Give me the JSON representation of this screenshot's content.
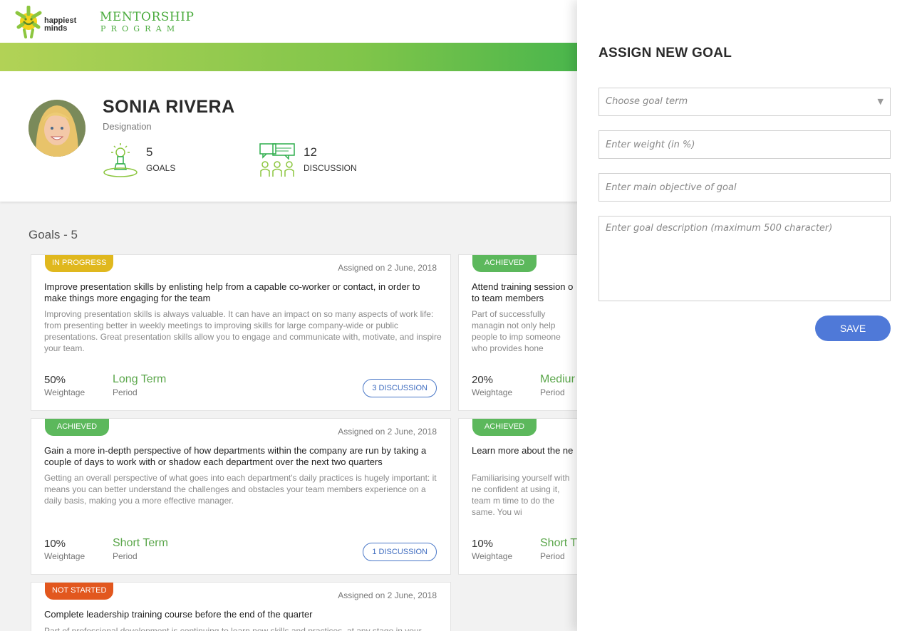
{
  "header": {
    "logo_text_1": "happiest",
    "logo_text_2": "minds",
    "title": "MENTORSHIP",
    "subtitle": "PROGRAM"
  },
  "profile": {
    "name": "SONIA RIVERA",
    "designation": "Designation",
    "stats": {
      "goals_count": "5",
      "goals_label": "GOALS",
      "discussion_count": "12",
      "discussion_label": "DISCUSSION"
    }
  },
  "goals_heading": "Goals - 5",
  "goals": [
    {
      "status": "IN PROGRESS",
      "status_color": "#e0b81e",
      "assigned": "Assigned on 2 June, 2018",
      "title": "Improve presentation skills by enlisting help from a capable co-worker or contact, in order to make things more engaging for the team",
      "description": "Improving presentation skills is always valuable. It can have an impact on so many aspects of work life: from presenting better in weekly meetings to improving skills for large company-wide or public presentations. Great presentation skills allow you to engage and communicate with, motivate, and inspire your team.",
      "weightage": "50%",
      "weightage_label": "Weightage",
      "period": "Long Term",
      "period_label": "Period",
      "discussion": "3 DISCUSSION"
    },
    {
      "status": "ACHIEVED",
      "status_color": "#5cb85c",
      "title": "Attend training session o to team members",
      "description": "Part of successfully managin not only help people to imp someone who provides hone",
      "weightage": "20%",
      "weightage_label": "Weightage",
      "period": "Mediur",
      "period_label": "Period"
    },
    {
      "status": "ACHIEVED",
      "status_color": "#5cb85c",
      "assigned": "Assigned on 2 June, 2018",
      "title": "Gain a more in-depth perspective of how departments within the company are run by taking a couple of days to work with or shadow each department over the next two quarters",
      "description": "Getting an overall perspective of what goes into each department's daily practices is hugely important: it means you can better understand the challenges and obstacles your team members experience on a daily basis, making you a more effective manager.",
      "weightage": "10%",
      "weightage_label": "Weightage",
      "period": "Short Term",
      "period_label": "Period",
      "discussion": "1 DISCUSSION"
    },
    {
      "status": "ACHIEVED",
      "status_color": "#5cb85c",
      "title": "Learn more about the ne",
      "description": "Familiarising yourself with ne confident at using it, team m time to do the same. You wi",
      "weightage": "10%",
      "weightage_label": "Weightage",
      "period": "Short T",
      "period_label": "Period"
    },
    {
      "status": "NOT STARTED",
      "status_color": "#e2571e",
      "assigned": "Assigned on 2 June, 2018",
      "title": "Complete leadership training course before the end of the quarter",
      "description": "Part of professional development is continuing to learn new skills and practices, at any stage in your"
    }
  ],
  "drawer": {
    "title": "ASSIGN NEW GOAL",
    "goal_term_placeholder": "Choose goal term",
    "weight_placeholder": "Enter weight (in %)",
    "objective_placeholder": "Enter main objective of goal",
    "description_placeholder": "Enter goal description (maximum 500 character)",
    "save_label": "SAVE"
  }
}
